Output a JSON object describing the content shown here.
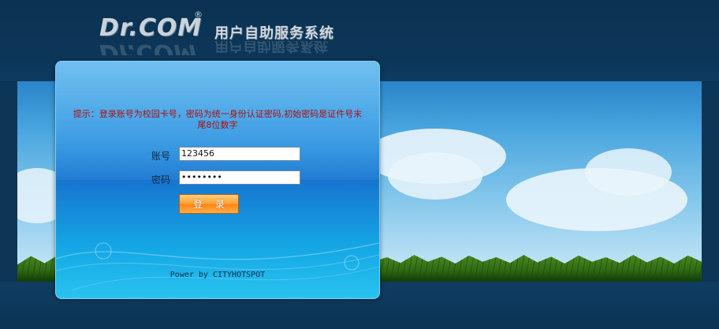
{
  "header": {
    "logo_text": "Dr.COM",
    "registered_mark": "®",
    "system_title": "用户自助服务系统"
  },
  "login": {
    "notice": "提示：登录账号为校园卡号，密码为统一身份认证密码,初始密码是证件号末尾8位数字",
    "account_label": "账号",
    "account_value": "123456",
    "password_label": "密码",
    "password_value": "12345678",
    "login_button": "登 录"
  },
  "footer": {
    "powered_by": "Power by CITYHOTSPOT"
  },
  "colors": {
    "page_bg": "#0d3556",
    "panel_blue": "#1f8ddf",
    "notice_red": "#b10d0d",
    "button_orange": "#ff8616"
  }
}
